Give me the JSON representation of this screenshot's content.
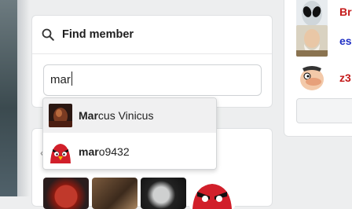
{
  "find_member": {
    "title": "Find member",
    "search_value": "mar",
    "search_icon": "search-icon"
  },
  "suggestions": [
    {
      "match": "Mar",
      "rest": "cus Vinicus",
      "avatar": "dark-portrait-avatar"
    },
    {
      "match": "mar",
      "rest": "o9432",
      "avatar": "angry-bird-avatar"
    }
  ],
  "right_members": [
    {
      "name": "Br",
      "color": "#c41a1a",
      "avatar": "alien-avatar"
    },
    {
      "name": "es",
      "color": "#1f2fc4",
      "avatar": "old-man-avatar"
    },
    {
      "name": "z3",
      "color": "#c41a1a",
      "avatar": "cartoon-face-avatar"
    }
  ],
  "colors": {
    "page_bg": "#edeeef",
    "card_bg": "#ffffff",
    "border": "#dfe1e3",
    "highlight": "#f0f0f1"
  }
}
